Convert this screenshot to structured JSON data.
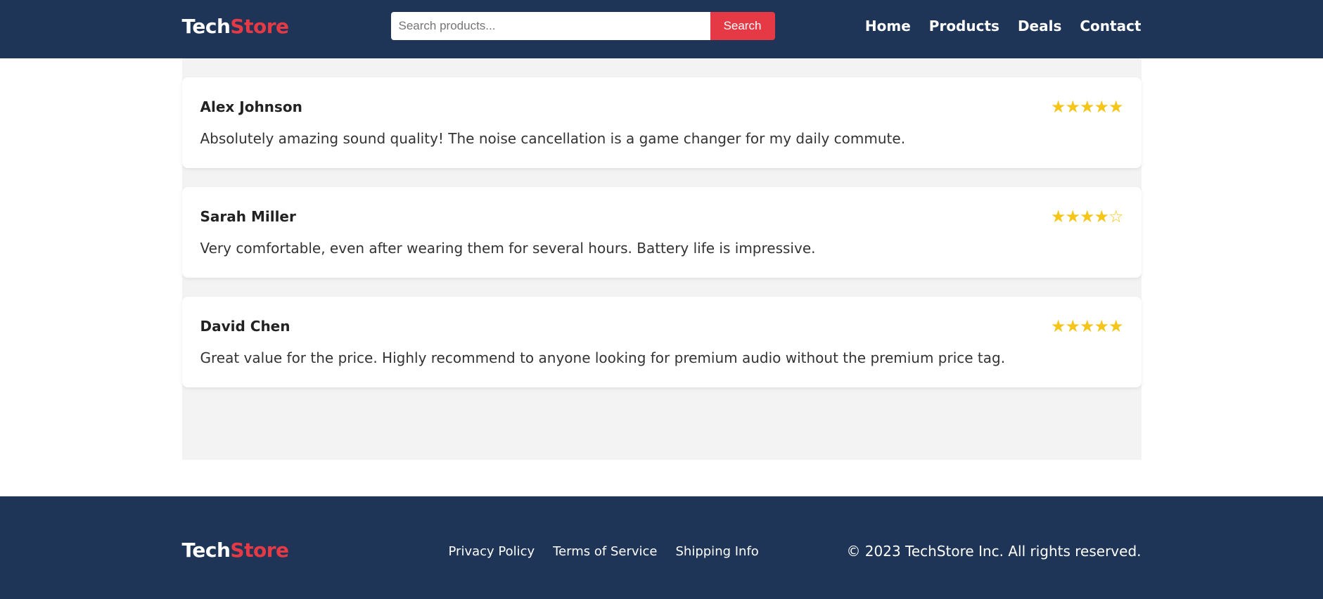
{
  "brand": {
    "part1": "Tech",
    "part2": "Store"
  },
  "search": {
    "placeholder": "Search products...",
    "button_label": "Search"
  },
  "nav": {
    "home": "Home",
    "products": "Products",
    "deals": "Deals",
    "contact": "Contact"
  },
  "reviews": [
    {
      "name": "Alex Johnson",
      "rating": 5,
      "stars": "★★★★★",
      "text": "Absolutely amazing sound quality! The noise cancellation is a game changer for my daily commute."
    },
    {
      "name": "Sarah Miller",
      "rating": 4,
      "stars": "★★★★☆",
      "text": "Very comfortable, even after wearing them for several hours. Battery life is impressive."
    },
    {
      "name": "David Chen",
      "rating": 5,
      "stars": "★★★★★",
      "text": "Great value for the price. Highly recommend to anyone looking for premium audio without the premium price tag."
    }
  ],
  "footer": {
    "links": {
      "privacy": "Privacy Policy",
      "terms": "Terms of Service",
      "shipping": "Shipping Info"
    },
    "copyright": "© 2023 TechStore Inc. All rights reserved."
  },
  "colors": {
    "header_bg": "#1f3558",
    "accent": "#e63946",
    "star": "#f5c518",
    "main_bg": "#f3f3f3"
  }
}
